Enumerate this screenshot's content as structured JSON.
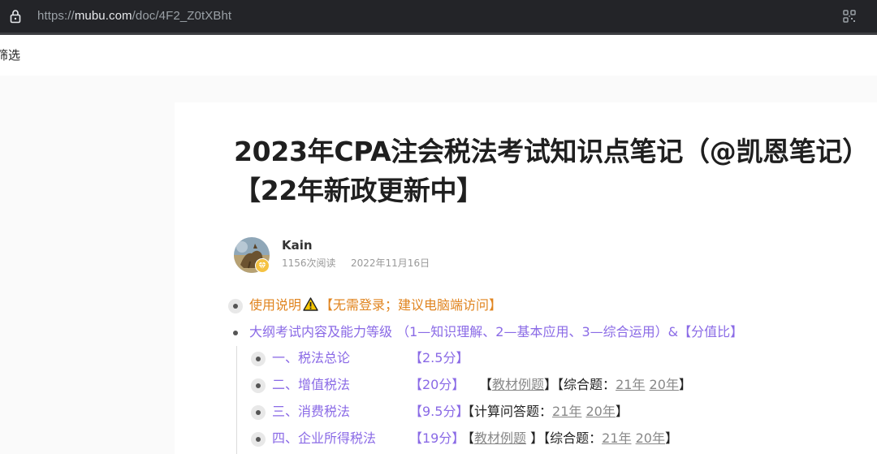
{
  "browser": {
    "url_prefix": "https://",
    "url_host": "mubu.com",
    "url_path": "/doc/4F2_Z0tXBht"
  },
  "filter": {
    "label": "筛选"
  },
  "doc": {
    "title": "2023年CPA注会税法考试知识点笔记（@凯恩笔记）【22年新政更新中】",
    "author": {
      "name": "Kain",
      "reads": "1156次阅读",
      "date": "2022年11月16日"
    }
  },
  "outline": {
    "item1": {
      "text": "使用说明",
      "note": "【无需登录；建议电脑端访问】"
    },
    "item2": {
      "text": "大纲考试内容及能力等级 （1—知识理解、2—基本应用、3—综合运用）&【分值比】"
    },
    "sub1": {
      "name": "一、税法总论",
      "score": "【2.5分】"
    },
    "sub2": {
      "name": "二、增值税法",
      "score": "【20分】",
      "open": "【",
      "link": "教材例题",
      "close": "】",
      "label": "【综合题：",
      "y1": "21年",
      "y2": "20年",
      "end": "】"
    },
    "sub3": {
      "name": "三、消费税法",
      "score": "【9.5分】",
      "label": "【计算问答题：",
      "y1": "21年",
      "y2": "20年",
      "end": "】"
    },
    "sub4": {
      "name": "四、企业所得税法",
      "score": "【19分】",
      "open": "【",
      "link": "教材例题",
      "close": " 】",
      "label": "【综合题：",
      "y1": "21年",
      "y2": "20年",
      "end": "】"
    }
  }
}
